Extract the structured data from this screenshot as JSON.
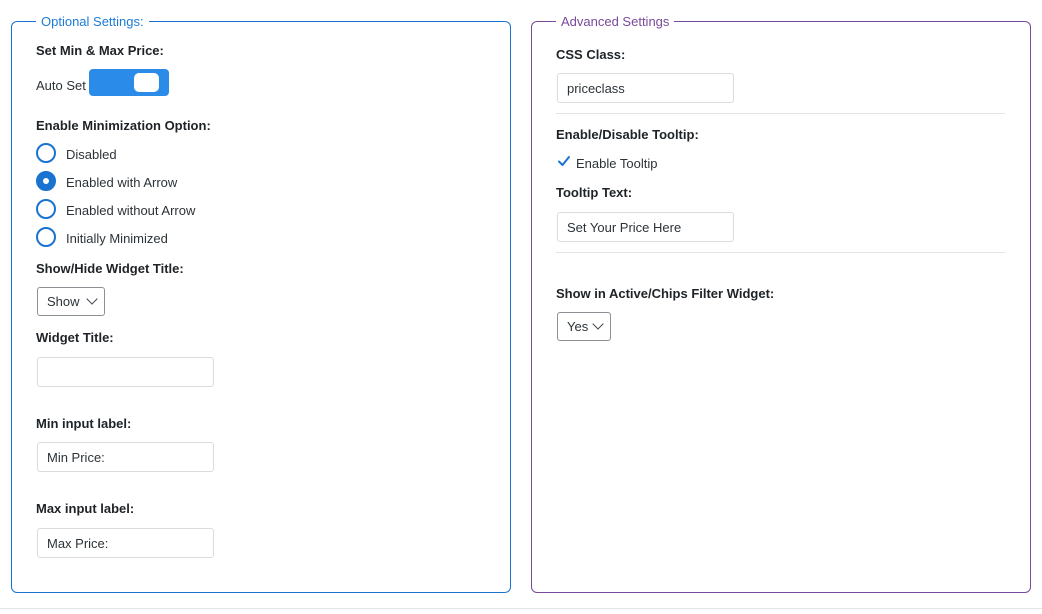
{
  "optional": {
    "legend": "Optional Settings:",
    "set_min_max_label": "Set Min & Max Price:",
    "auto_set_label": "Auto Set",
    "auto_set_on": true,
    "minimization_label": "Enable Minimization Option:",
    "minimization_options": [
      "Disabled",
      "Enabled with Arrow",
      "Enabled without Arrow",
      "Initially Minimized"
    ],
    "minimization_selected": "Enabled with Arrow",
    "show_hide_title_label": "Show/Hide Widget Title:",
    "show_hide_title_value": "Show",
    "widget_title_label": "Widget Title:",
    "widget_title_value": "",
    "min_input_label": "Min input label:",
    "min_input_value": "Min Price:",
    "max_input_label": "Max input label:",
    "max_input_value": "Max Price:"
  },
  "advanced": {
    "legend": "Advanced Settings",
    "css_class_label": "CSS Class:",
    "css_class_value": "priceclass",
    "tooltip_toggle_label": "Enable/Disable Tooltip:",
    "tooltip_checkbox_label": "Enable Tooltip",
    "tooltip_checked": true,
    "tooltip_text_label": "Tooltip Text:",
    "tooltip_text_value": "Set Your Price Here",
    "chips_label": "Show in Active/Chips Filter Widget:",
    "chips_value": "Yes"
  },
  "colors": {
    "optional_border": "#1a73d0",
    "advanced_border": "#7a4a9a",
    "toggle_on": "#2a8be8"
  }
}
